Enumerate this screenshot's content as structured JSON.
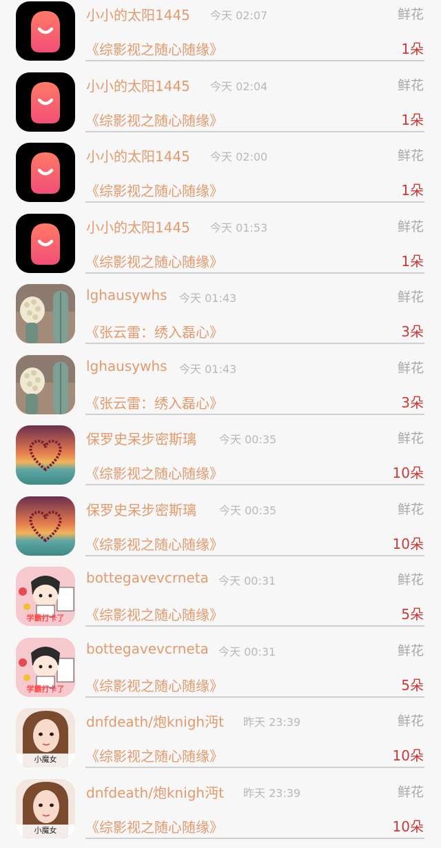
{
  "gifts": [
    {
      "user": "小小的太阳1445",
      "time": "今天 02:07",
      "type": "鲜花",
      "book": "《综影视之随心随缘》",
      "count": "1朵",
      "avatar": "app-logo"
    },
    {
      "user": "小小的太阳1445",
      "time": "今天 02:04",
      "type": "鲜花",
      "book": "《综影视之随心随缘》",
      "count": "1朵",
      "avatar": "app-logo"
    },
    {
      "user": "小小的太阳1445",
      "time": "今天 02:00",
      "type": "鲜花",
      "book": "《综影视之随心随缘》",
      "count": "1朵",
      "avatar": "app-logo"
    },
    {
      "user": "小小的太阳1445",
      "time": "今天 01:53",
      "type": "鲜花",
      "book": "《综影视之随心随缘》",
      "count": "1朵",
      "avatar": "app-logo"
    },
    {
      "user": "lghausywhs",
      "time": "今天 01:43",
      "type": "鲜花",
      "book": "《张云雷：绣入磊心》",
      "count": "3朵",
      "avatar": "cactus-photo"
    },
    {
      "user": "lghausywhs",
      "time": "今天 01:43",
      "type": "鲜花",
      "book": "《张云雷：绣入磊心》",
      "count": "3朵",
      "avatar": "cactus-photo"
    },
    {
      "user": "保罗史呆步密斯璃",
      "time": "今天 00:35",
      "type": "鲜花",
      "book": "《综影视之随心随缘》",
      "count": "10朵",
      "avatar": "heart-sunset"
    },
    {
      "user": "保罗史呆步密斯璃",
      "time": "今天 00:35",
      "type": "鲜花",
      "book": "《综影视之随心随缘》",
      "count": "10朵",
      "avatar": "heart-sunset"
    },
    {
      "user": "bottegavevcrneta",
      "time": "今天 00:31",
      "type": "鲜花",
      "book": "《综影视之随心随缘》",
      "count": "5朵",
      "avatar": "cartoon-girl"
    },
    {
      "user": "bottegavevcrneta",
      "time": "今天 00:31",
      "type": "鲜花",
      "book": "《综影视之随心随缘》",
      "count": "5朵",
      "avatar": "cartoon-girl"
    },
    {
      "user": "dnfdeath/炮knigh沔t",
      "time": "昨天 23:39",
      "type": "鲜花",
      "book": "《综影视之随心随缘》",
      "count": "10朵",
      "avatar": "portrait-girl"
    },
    {
      "user": "dnfdeath/炮knigh沔t",
      "time": "昨天 23:39",
      "type": "鲜花",
      "book": "《综影视之随心随缘》",
      "count": "10朵",
      "avatar": "portrait-girl"
    }
  ],
  "avatar_badges": {
    "cartoon-girl": "学霸打卡了",
    "portrait-girl": "小魔女"
  },
  "colors": {
    "username": "#e39a6d",
    "count": "#c93a37",
    "muted": "#b8b8b8",
    "background": "#f7f7f7"
  }
}
